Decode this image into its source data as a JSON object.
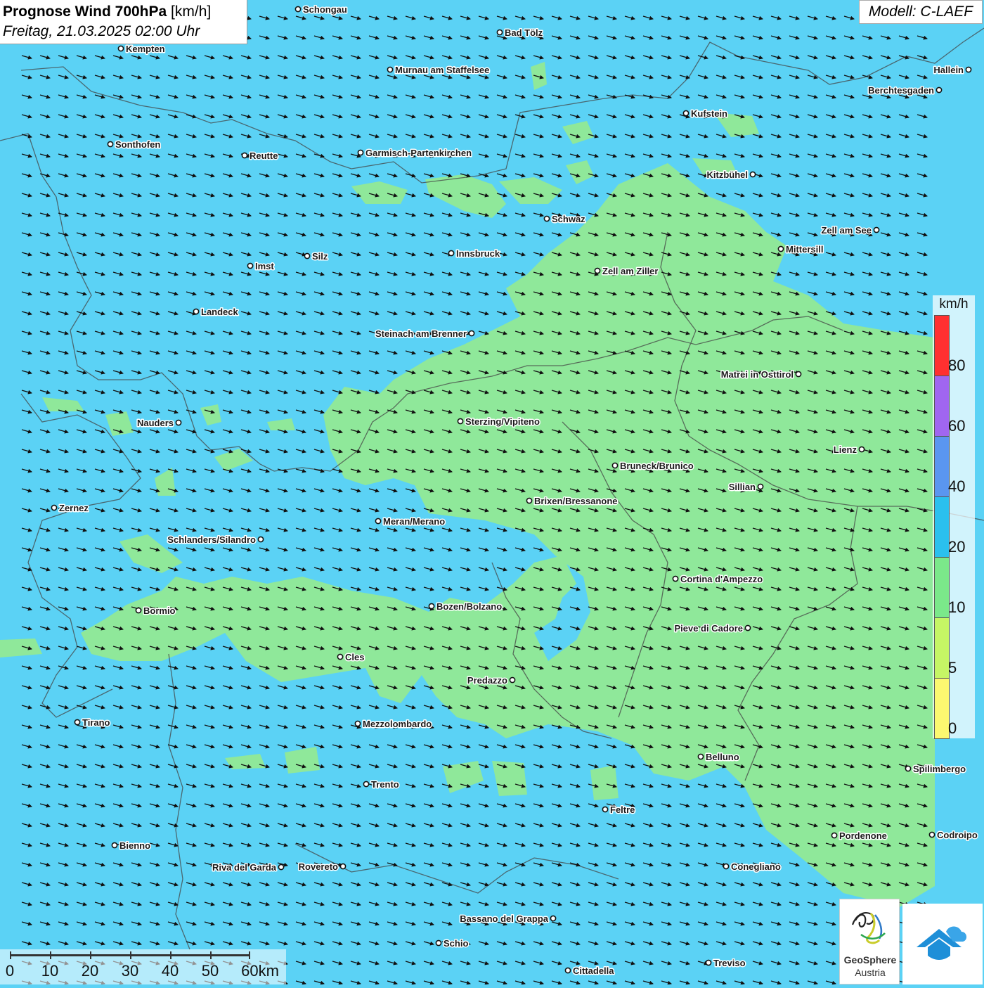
{
  "header": {
    "title_bold": "Prognose Wind 700hPa",
    "title_unit": "[km/h]",
    "datetime": "Freitag, 21.03.2025 02:00 Uhr",
    "model": "Modell: C-LAEF"
  },
  "legend": {
    "unit": "km/h",
    "labels": [
      "80",
      "60",
      "40",
      "20",
      "10",
      "5",
      "0"
    ],
    "colors": [
      "#ff3030",
      "#a066f0",
      "#5a96f0",
      "#2bc0ee",
      "#7be88a",
      "#c6f565",
      "#fcf870"
    ]
  },
  "scalebar": {
    "labels": [
      "0",
      "10",
      "20",
      "30",
      "40",
      "50",
      "60km"
    ]
  },
  "logos": {
    "geosphere_line1": "GeoSphere",
    "geosphere_line2": "Austria"
  },
  "wind": {
    "direction": "east-south-east",
    "background_color": "#5bd2f5",
    "light_wind_color": "#8fe89a",
    "arrow_color": "#111111"
  },
  "cities": [
    {
      "name": "Schongau"
    },
    {
      "name": "Bad Tölz"
    },
    {
      "name": "Kempten"
    },
    {
      "name": "Murnau am Staffelsee"
    },
    {
      "name": "Hallein"
    },
    {
      "name": "Berchtesgaden"
    },
    {
      "name": "Kufstein"
    },
    {
      "name": "Sonthofen"
    },
    {
      "name": "Reutte"
    },
    {
      "name": "Garmisch-Partenkirchen"
    },
    {
      "name": "Kitzbühel"
    },
    {
      "name": "Schwaz"
    },
    {
      "name": "Zell am See"
    },
    {
      "name": "Mittersill"
    },
    {
      "name": "Innsbruck"
    },
    {
      "name": "Silz"
    },
    {
      "name": "Imst"
    },
    {
      "name": "Zell am Ziller"
    },
    {
      "name": "Landeck"
    },
    {
      "name": "Steinach am Brenner"
    },
    {
      "name": "Matrei in Osttirol"
    },
    {
      "name": "Nauders"
    },
    {
      "name": "Sterzing/Vipiteno"
    },
    {
      "name": "Lienz"
    },
    {
      "name": "Bruneck/Brunico"
    },
    {
      "name": "Sillian"
    },
    {
      "name": "Brixen/Bressanone"
    },
    {
      "name": "Zernez"
    },
    {
      "name": "Meran/Merano"
    },
    {
      "name": "Schlanders/Silandro"
    },
    {
      "name": "Cortina d'Ampezzo"
    },
    {
      "name": "Bozen/Bolzano"
    },
    {
      "name": "Bormio"
    },
    {
      "name": "Pieve di Cadore"
    },
    {
      "name": "Cles"
    },
    {
      "name": "Predazzo"
    },
    {
      "name": "Tirano"
    },
    {
      "name": "Mezzolombardo"
    },
    {
      "name": "Belluno"
    },
    {
      "name": "Spilimbergo"
    },
    {
      "name": "Trento"
    },
    {
      "name": "Feltre"
    },
    {
      "name": "Pordenone"
    },
    {
      "name": "Codroipo"
    },
    {
      "name": "Bienno"
    },
    {
      "name": "Riva del Garda"
    },
    {
      "name": "Rovereto"
    },
    {
      "name": "Conegliano"
    },
    {
      "name": "Bassano del Grappa"
    },
    {
      "name": "Schio"
    },
    {
      "name": "Treviso"
    },
    {
      "name": "Cittadella"
    }
  ]
}
